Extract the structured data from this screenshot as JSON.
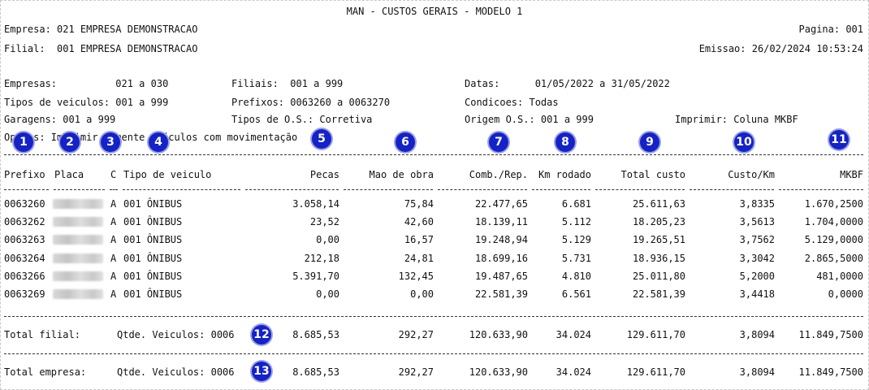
{
  "report": {
    "title": "MAN - CUSTOS GERAIS - MODELO 1",
    "empresa": "Empresa: 021 EMPRESA DEMONSTRACAO",
    "filial": "Filial:  001 EMPRESA DEMONSTRACAO",
    "pagina": "Pagina: 001",
    "emissao": "Emissao: 26/02/2024 10:53:24"
  },
  "filters": {
    "empresas": "Empresas:          021 a 030",
    "filiais": "Filiais:  001 a 999",
    "datas": "Datas:      01/05/2022 a 31/05/2022",
    "tipos_veiculos": "Tipos de veiculos: 001 a 999",
    "prefixos": "Prefixos: 0063260 a 0063270",
    "condicoes": "Condicoes: Todas",
    "garagens": "Garagens: 001 a 999",
    "tipos_os": "Tipos de O.S.: Corretiva",
    "origem_os": "Origem O.S.: 001 a 999",
    "imprimir": "Imprimir: Coluna MKBF",
    "opcoes": "Opções: Imprimir somente veículos com movimentação"
  },
  "columns": {
    "prefixo": "Prefixo",
    "placa": "Placa",
    "c": "C",
    "tipo": "Tipo de veiculo",
    "pecas": "Pecas",
    "mao": "Mao de obra",
    "comb": "Comb./Rep.",
    "km": "Km rodado",
    "total": "Total custo",
    "custokm": "Custo/Km",
    "mkbf": "MKBF"
  },
  "rows": [
    {
      "prefixo": "0063260",
      "c": "A",
      "tipo": "001 ÔNIBUS",
      "pecas": "3.058,14",
      "mao": "75,84",
      "comb": "22.477,65",
      "km": "6.681",
      "total": "25.611,63",
      "custokm": "3,8335",
      "mkbf": "1.670,2500"
    },
    {
      "prefixo": "0063262",
      "c": "A",
      "tipo": "001 ÔNIBUS",
      "pecas": "23,52",
      "mao": "42,60",
      "comb": "18.139,11",
      "km": "5.112",
      "total": "18.205,23",
      "custokm": "3,5613",
      "mkbf": "1.704,0000"
    },
    {
      "prefixo": "0063263",
      "c": "A",
      "tipo": "001 ÔNIBUS",
      "pecas": "0,00",
      "mao": "16,57",
      "comb": "19.248,94",
      "km": "5.129",
      "total": "19.265,51",
      "custokm": "3,7562",
      "mkbf": "5.129,0000"
    },
    {
      "prefixo": "0063264",
      "c": "A",
      "tipo": "001 ÔNIBUS",
      "pecas": "212,18",
      "mao": "24,81",
      "comb": "18.699,16",
      "km": "5.731",
      "total": "18.936,15",
      "custokm": "3,3042",
      "mkbf": "2.865,5000"
    },
    {
      "prefixo": "0063266",
      "c": "A",
      "tipo": "001 ÔNIBUS",
      "pecas": "5.391,70",
      "mao": "132,45",
      "comb": "19.487,65",
      "km": "4.810",
      "total": "25.011,80",
      "custokm": "5,2000",
      "mkbf": "481,0000"
    },
    {
      "prefixo": "0063269",
      "c": "A",
      "tipo": "001 ÔNIBUS",
      "pecas": "0,00",
      "mao": "0,00",
      "comb": "22.581,39",
      "km": "6.561",
      "total": "22.581,39",
      "custokm": "3,4418",
      "mkbf": "0,0000"
    }
  ],
  "totals": [
    {
      "label": "Total filial:",
      "qtde": "Qtde. Veiculos: 0006",
      "pecas": "8.685,53",
      "mao": "292,27",
      "comb": "120.633,90",
      "km": "34.024",
      "total": "129.611,70",
      "custokm": "3,8094",
      "mkbf": "11.849,7500"
    },
    {
      "label": "Total empresa:",
      "qtde": "Qtde. Veiculos: 0006",
      "pecas": "8.685,53",
      "mao": "292,27",
      "comb": "120.633,90",
      "km": "34.024",
      "total": "129.611,70",
      "custokm": "3,8094",
      "mkbf": "11.849,7500"
    }
  ],
  "badges": [
    "1",
    "2",
    "3",
    "4",
    "5",
    "6",
    "7",
    "8",
    "9",
    "10",
    "11",
    "12",
    "13"
  ],
  "colors": {
    "badge": "#1422c8"
  }
}
